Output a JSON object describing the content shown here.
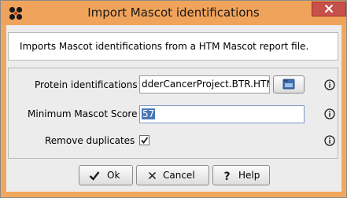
{
  "window": {
    "title": "Import Mascot identifications",
    "close_icon": "close-icon",
    "app_logo_icon": "app-logo-icon",
    "title_bar_color": "#f0a35a"
  },
  "description": {
    "text": "Imports Mascot identifications from a HTM Mascot report file."
  },
  "parameters": {
    "protein_identifications": {
      "label": "Protein identifications",
      "value": "dderCancerProject.BTR.HTM",
      "browse_icon": "folder-open-icon",
      "info_icon": "info-icon"
    },
    "minimum_score": {
      "label": "Minimum Mascot Score",
      "value": "57",
      "info_icon": "info-icon"
    },
    "remove_duplicates": {
      "label": "Remove duplicates",
      "checked": true,
      "info_icon": "info-icon"
    }
  },
  "buttons": {
    "ok": {
      "label": "Ok",
      "icon": "check-icon"
    },
    "cancel": {
      "label": "Cancel",
      "icon": "x-icon"
    },
    "help": {
      "label": "Help",
      "icon": "question-icon"
    }
  },
  "colors": {
    "selection": "#4a78b8",
    "close_button": "#c7504a"
  }
}
